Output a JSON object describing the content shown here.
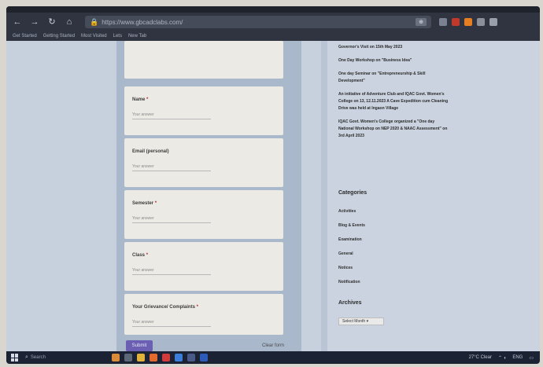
{
  "browser": {
    "url": "https://www.gbcadclabs.com/",
    "bookmarks": [
      "Get Started",
      "Getting Started",
      "Most Visited",
      "Lets",
      "New Tab"
    ]
  },
  "form": {
    "questions": [
      {
        "label": "Name",
        "required": "*",
        "placeholder": "Your answer"
      },
      {
        "label": "Email (personal)",
        "required": "",
        "placeholder": "Your answer"
      },
      {
        "label": "Semester",
        "required": "*",
        "placeholder": "Your answer"
      },
      {
        "label": "Class",
        "required": "*",
        "placeholder": "Your answer"
      },
      {
        "label": "Your Grievance/ Complaints",
        "required": "*",
        "placeholder": "Your answer"
      }
    ],
    "submit_label": "Submit",
    "clear_label": "Clear form"
  },
  "sidebar": {
    "posts": [
      "Governor's Visit on 15th May 2023",
      "One Day Workshop on \"Business Idea\"",
      "One day Seminar on \"Entrepreneurship & Skill Development\"",
      "An initiative of Adventure Club and IQAC Govt. Women's College on 13, 12.11.2023 A Cave Expedition cum Cleaning Drive was held at Ingaon Village",
      "IQAC Govt. Women's College organized a \"One day National Workshop on NEP 2020 & NAAC Assessment\" on 3rd April 2023"
    ],
    "categories_title": "Categories",
    "categories": [
      "Activities",
      "Blog & Events",
      "Examination",
      "General",
      "Notices",
      "Notification"
    ],
    "archives_title": "Archives",
    "archives_select": "Select Month"
  },
  "taskbar": {
    "search_placeholder": "Search",
    "weather": "27°C Clear",
    "lang": "ENG"
  }
}
